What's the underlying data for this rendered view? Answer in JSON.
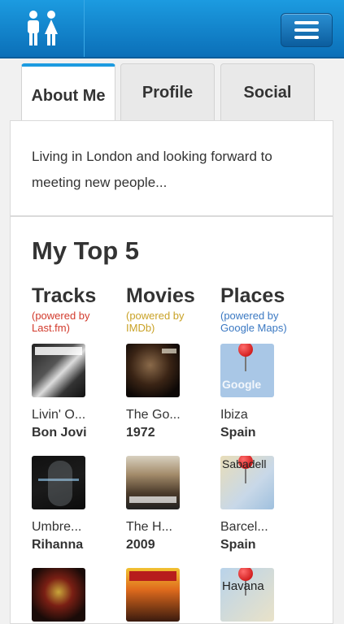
{
  "header": {
    "logo_icon": "couple-icon",
    "menu_icon": "hamburger-icon"
  },
  "tabs": [
    {
      "label": "About Me"
    },
    {
      "label": "Profile"
    },
    {
      "label": "Social"
    }
  ],
  "about": {
    "text": "Living in London and looking forward to meeting new people..."
  },
  "top5": {
    "heading": "My Top 5",
    "columns": [
      {
        "title": "Tracks",
        "powered": "(powered by Last.fm)",
        "color": "#d23a2c",
        "items": [
          {
            "title": "Livin' O...",
            "sub": "Bon Jovi"
          },
          {
            "title": "Umbre...",
            "sub": "Rihanna"
          },
          {
            "title": "",
            "sub": ""
          }
        ]
      },
      {
        "title": "Movies",
        "powered": "(powered by IMDb)",
        "color": "#c9a227",
        "items": [
          {
            "title": "The Go...",
            "sub": "1972"
          },
          {
            "title": "The H...",
            "sub": "2009"
          },
          {
            "title": "",
            "sub": ""
          }
        ]
      },
      {
        "title": "Places",
        "powered": "(powered by Google Maps)",
        "color": "#3a78c2",
        "items": [
          {
            "title": "Ibiza",
            "sub": "Spain",
            "map_text": "Google"
          },
          {
            "title": "Barcel...",
            "sub": "Spain",
            "map_text": "Sabadell"
          },
          {
            "title": "",
            "sub": "",
            "map_text": "Havana"
          }
        ]
      }
    ]
  }
}
